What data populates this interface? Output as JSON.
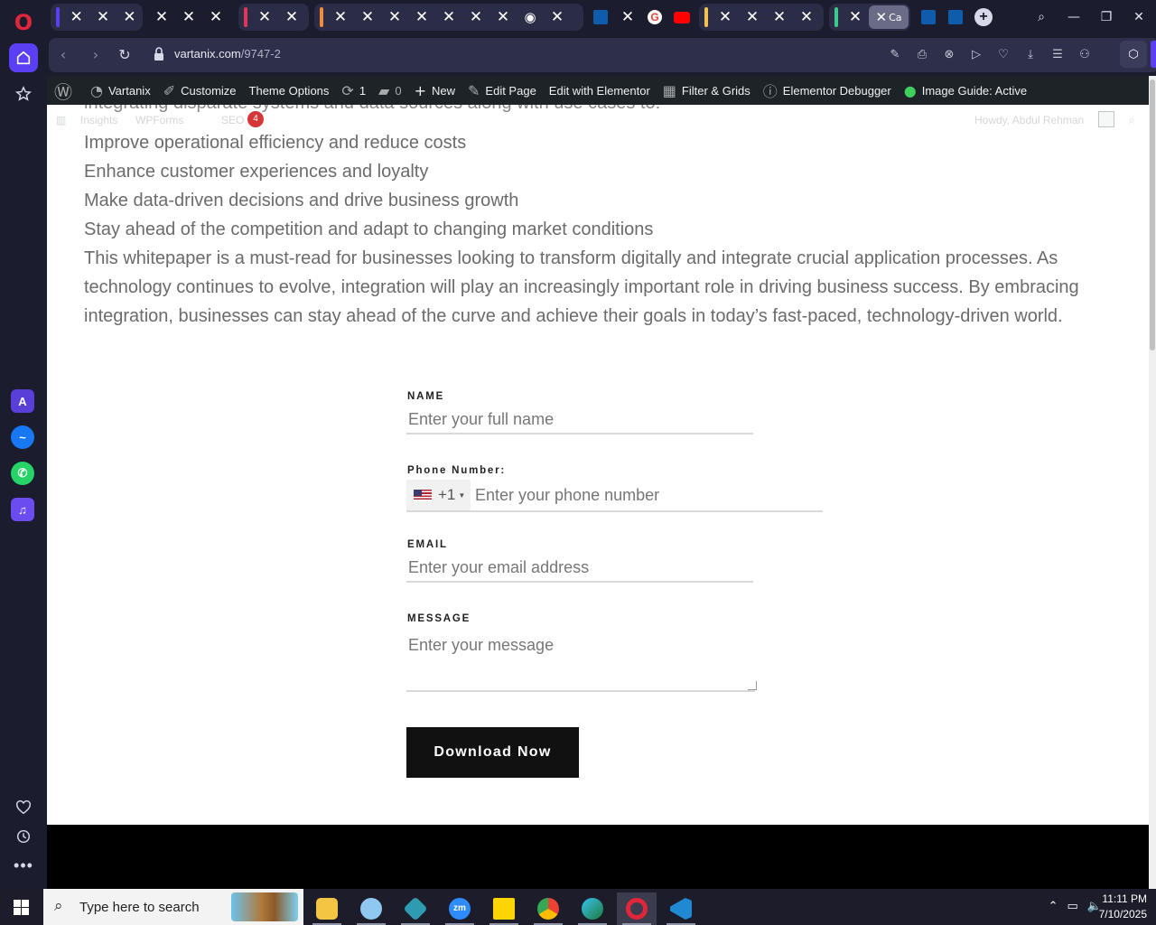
{
  "browser": {
    "active_tab_label": "Ca",
    "url_host": "vartanix.com",
    "url_path": "/9747-2"
  },
  "wp_admin_bar": {
    "site_name": "Vartanix",
    "customize": "Customize",
    "theme_options": "Theme Options",
    "updates_count": "1",
    "comments_count": "0",
    "new": "New",
    "edit_page": "Edit Page",
    "edit_with_elementor": "Edit with Elementor",
    "filter_grids": "Filter & Grids",
    "elementor_debugger": "Elementor Debugger",
    "image_guide": "Image Guide: Active",
    "secondary": {
      "insights": "Insights",
      "wpforms": "WPForms",
      "seo": "SEO",
      "seo_badge": "4",
      "howdy": "Howdy, Abdul Rehman"
    }
  },
  "article": {
    "cut_line": "integrating disparate systems and data sources along with use cases to:",
    "bullets": [
      "Improve operational efficiency and reduce costs",
      "Enhance customer experiences and loyalty",
      "Make data-driven decisions and drive business growth",
      "Stay ahead of the competition and adapt to changing market conditions"
    ],
    "paragraph": "This whitepaper is a must-read for businesses looking to transform digitally and integrate crucial application processes. As technology continues to evolve, integration will play an increasingly important role in driving business success. By embracing integration, businesses can stay ahead of the curve and achieve their goals in today’s fast-paced, technology-driven world."
  },
  "form": {
    "name_label": "NAME",
    "name_placeholder": "Enter your full name",
    "phone_label": "Phone Number:",
    "phone_code": "+1",
    "phone_placeholder": "Enter your phone number",
    "email_label": "EMAIL",
    "email_placeholder": "Enter your email address",
    "message_label": "MESSAGE",
    "message_placeholder": "Enter your message",
    "submit_label": "Download Now"
  },
  "taskbar": {
    "search_placeholder": "Type here to search",
    "time": "11:11 PM",
    "date": "7/10/2025"
  },
  "colors": {
    "opera_bg": "#1b1c2e",
    "opera_accent": "#5b3ff5",
    "wp_bar": "#1d2327",
    "button_bg": "#111111"
  }
}
